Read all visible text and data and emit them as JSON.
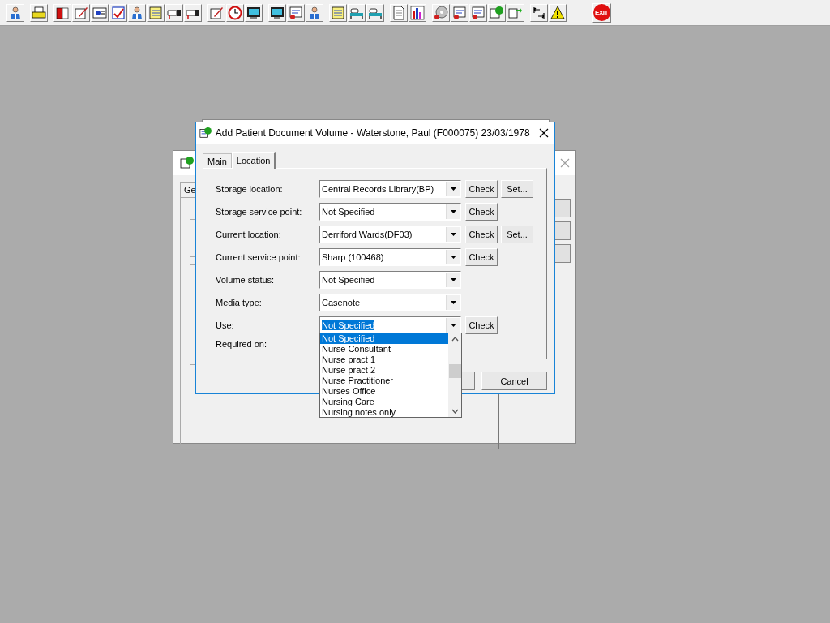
{
  "toolbar": {
    "exit_label": "EXIT"
  },
  "back_window": {
    "tab_label": "Ge"
  },
  "dialog": {
    "title": "Add Patient Document Volume - Waterstone, Paul (F000075) 23/03/1978",
    "tabs": [
      {
        "label": "Main",
        "selected": false
      },
      {
        "label": "Location",
        "selected": true
      }
    ],
    "fields": [
      {
        "label": "Storage location:",
        "value": "Central Records Library(BP)",
        "buttons": [
          "Check",
          "Set..."
        ],
        "focused": false
      },
      {
        "label": "Storage service point:",
        "value": "Not Specified",
        "buttons": [
          "Check"
        ],
        "focused": false
      },
      {
        "label": "Current location:",
        "value": "Derriford Wards(DF03)",
        "buttons": [
          "Check",
          "Set..."
        ],
        "focused": false
      },
      {
        "label": "Current service point:",
        "value": "Sharp (100468)",
        "buttons": [
          "Check"
        ],
        "focused": false
      },
      {
        "label": "Volume status:",
        "value": "Not Specified",
        "focused": false
      },
      {
        "label": "Media type:",
        "value": "Casenote",
        "focused": false
      },
      {
        "label": "Use:",
        "value": "Not Specified",
        "buttons": [
          "Check"
        ],
        "focused": true
      }
    ],
    "required_on": {
      "label": "Required on:"
    },
    "buttons": [
      "Cancel"
    ]
  },
  "dropdown": {
    "items": [
      {
        "label": "Not Specified",
        "selected": true
      },
      {
        "label": "Nurse Consultant",
        "selected": false
      },
      {
        "label": "Nurse pract 1",
        "selected": false
      },
      {
        "label": "Nurse pract 2",
        "selected": false
      },
      {
        "label": "Nurse Practitioner",
        "selected": false
      },
      {
        "label": "Nurses Office",
        "selected": false
      },
      {
        "label": "Nursing Care",
        "selected": false
      },
      {
        "label": "Nursing notes only",
        "selected": false
      }
    ]
  }
}
